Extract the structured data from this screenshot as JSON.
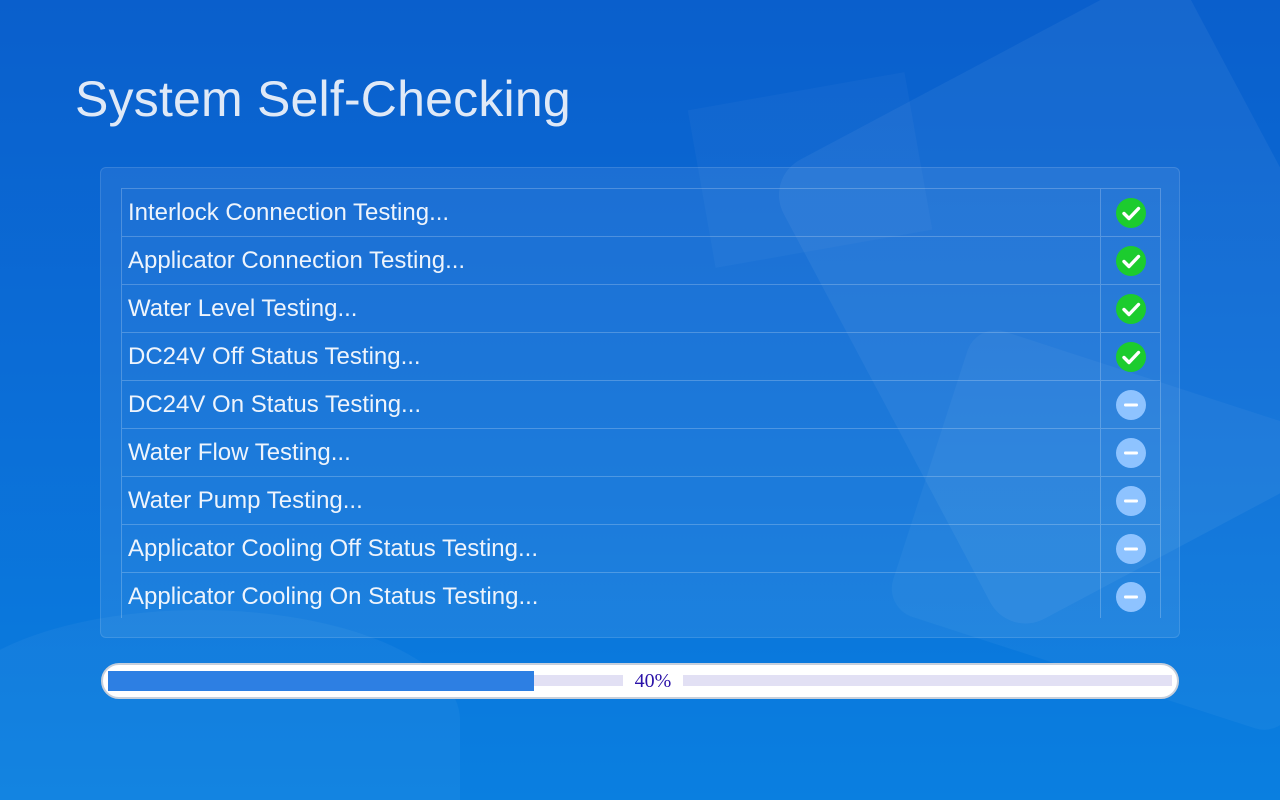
{
  "page": {
    "title": "System Self-Checking"
  },
  "colors": {
    "pass": "#1ccc2e",
    "pending": "#8ec3ff",
    "progress_fill": "#2d7fe3",
    "progress_text": "#2a12a8"
  },
  "checks": [
    {
      "label": "Interlock Connection Testing...",
      "status": "pass",
      "icon": "check-circle-icon"
    },
    {
      "label": "Applicator Connection Testing...",
      "status": "pass",
      "icon": "check-circle-icon"
    },
    {
      "label": "Water Level Testing...",
      "status": "pass",
      "icon": "check-circle-icon"
    },
    {
      "label": "DC24V Off Status Testing...",
      "status": "pass",
      "icon": "check-circle-icon"
    },
    {
      "label": "DC24V On Status Testing...",
      "status": "pending",
      "icon": "minus-circle-icon"
    },
    {
      "label": "Water Flow Testing...",
      "status": "pending",
      "icon": "minus-circle-icon"
    },
    {
      "label": "Water Pump Testing...",
      "status": "pending",
      "icon": "minus-circle-icon"
    },
    {
      "label": "Applicator Cooling Off Status Testing...",
      "status": "pending",
      "icon": "minus-circle-icon"
    },
    {
      "label": "Applicator Cooling On Status Testing...",
      "status": "pending",
      "icon": "minus-circle-icon"
    }
  ],
  "progress": {
    "value": 0.4,
    "text": "40%"
  }
}
